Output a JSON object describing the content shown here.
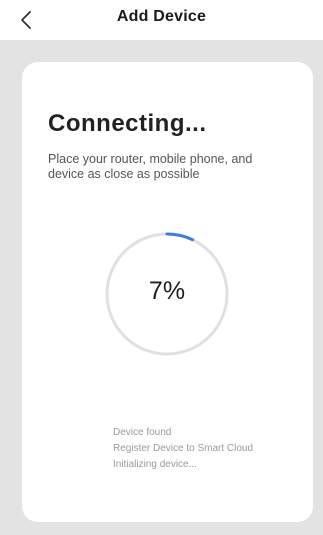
{
  "header": {
    "title": "Add Device",
    "back_icon": "chevron-left-icon"
  },
  "colors": {
    "background": "#e3e3e3",
    "card": "#ffffff",
    "progress_track": "#e0e0e0",
    "progress_arc": "#3a7fe0"
  },
  "card": {
    "title": "Connecting...",
    "subtitle": "Place your router, mobile phone, and device as close as possible"
  },
  "progress": {
    "percent": 7,
    "label": "7%"
  },
  "status_steps": [
    "Device found",
    "Register Device to Smart Cloud",
    "Initializing device..."
  ]
}
